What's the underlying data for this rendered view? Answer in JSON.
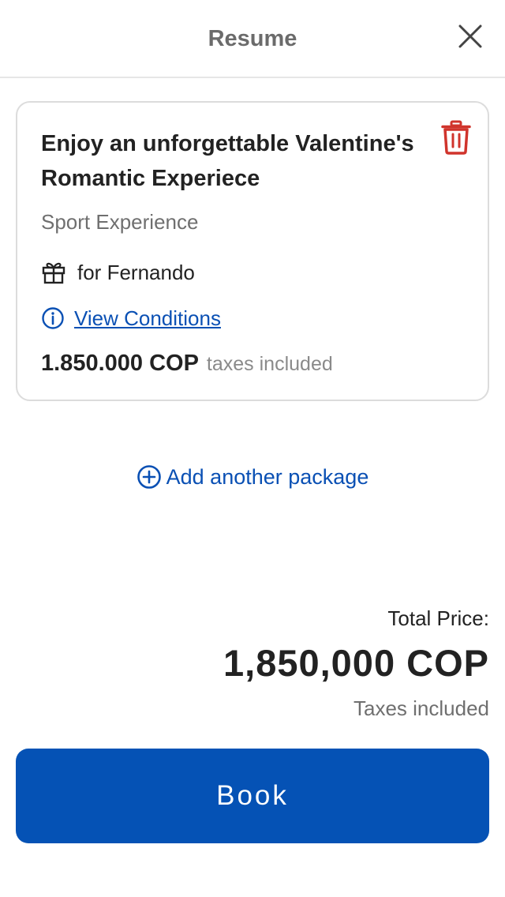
{
  "header": {
    "title": "Resume",
    "close_icon": "close-icon"
  },
  "package": {
    "title": "Enjoy an unforgettable Valentine's Romantic Experiece",
    "category": "Sport Experience",
    "gift_recipient": "for Fernando",
    "conditions_link": "View Conditions",
    "price": "1.850.000 COP",
    "price_note": "taxes included",
    "delete_icon": "trash-icon",
    "delete_color": "#d0342c"
  },
  "add_package": {
    "label": "Add another package",
    "icon": "plus-circle-icon"
  },
  "summary": {
    "total_label": "Total Price:",
    "total_value": "1,850,000 COP",
    "taxes_note": "Taxes included"
  },
  "actions": {
    "book_label": "Book"
  },
  "colors": {
    "accent": "#0552b5",
    "link": "#0a50b4",
    "danger": "#d0342c"
  }
}
